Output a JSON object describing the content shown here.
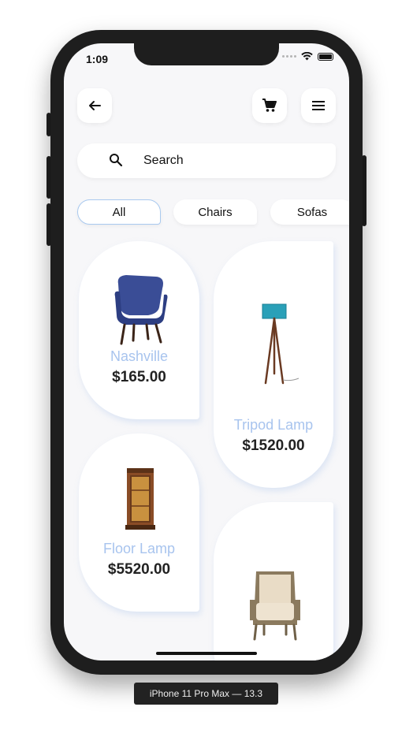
{
  "status": {
    "time": "1:09"
  },
  "header": {
    "back_icon": "arrow-left-icon",
    "cart_icon": "cart-icon",
    "menu_icon": "menu-icon"
  },
  "search": {
    "label": "Search",
    "icon": "search-icon"
  },
  "categories": [
    "All",
    "Chairs",
    "Sofas"
  ],
  "selected_category": "All",
  "products": [
    {
      "name": "Nashville",
      "price": "$165.00"
    },
    {
      "name": "Tripod Lamp",
      "price": "$1520.00"
    },
    {
      "name": "Floor Lamp",
      "price": "$5520.00"
    },
    {
      "name": "",
      "price": ""
    }
  ],
  "device_label": "iPhone 11 Pro Max — 13.3",
  "colors": {
    "accent": "#a8c4ee",
    "background": "#f7f7f9"
  }
}
